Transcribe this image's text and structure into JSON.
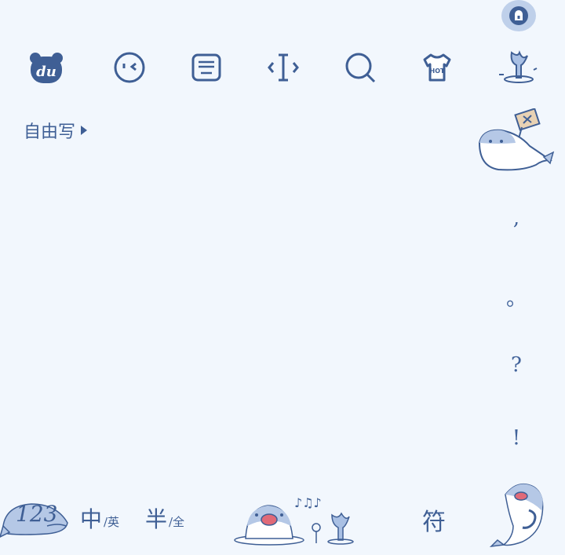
{
  "toolbar": {
    "icons": [
      {
        "name": "du-logo-icon",
        "label": "du"
      },
      {
        "name": "emoji-icon"
      },
      {
        "name": "keyboard-icon"
      },
      {
        "name": "cursor-move-icon"
      },
      {
        "name": "search-icon"
      },
      {
        "name": "skin-hot-icon",
        "label": "HOT"
      },
      {
        "name": "whale-tail-icon"
      }
    ]
  },
  "handwrite": {
    "mode_label": "自由写"
  },
  "punctuation": [
    ",",
    "。",
    "?",
    "!"
  ],
  "bottom_bar": {
    "num_key": "123",
    "lang_main": "中",
    "lang_sub": "/英",
    "width_main": "半",
    "width_sub": "/全",
    "symbol_key": "符"
  },
  "colors": {
    "background": "#f2f7fd",
    "accent": "#3f5f95",
    "accent_light": "#bfd0ea"
  }
}
